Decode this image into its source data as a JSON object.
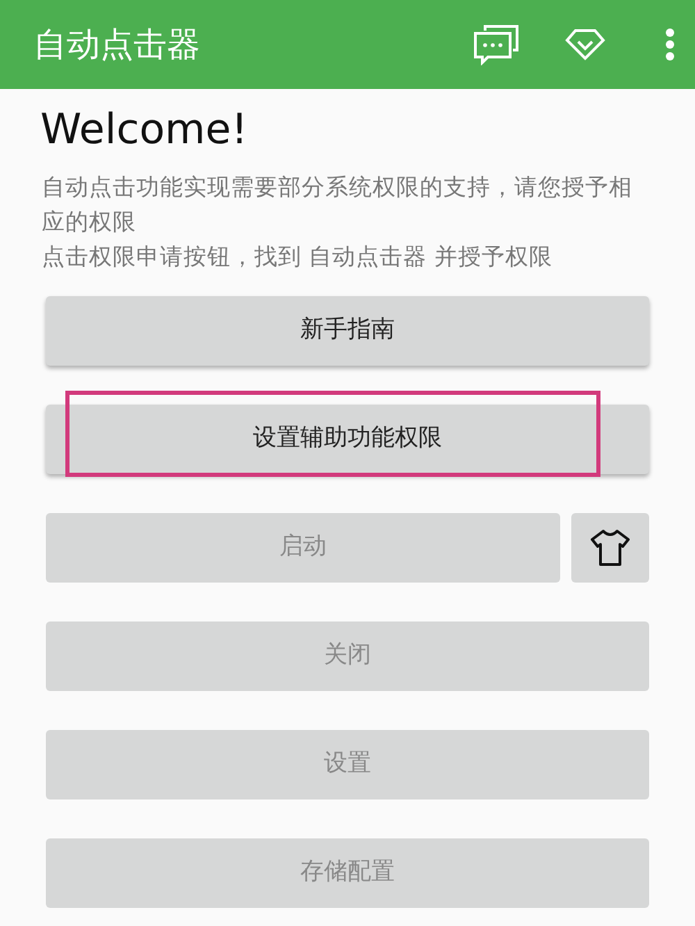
{
  "app_bar": {
    "title": "自动点击器"
  },
  "welcome": "Welcome!",
  "description": [
    "自动点击功能实现需要部分系统权限的支持，请您授予相应的权限",
    "点击权限申请按钮，找到 自动点击器 并授予权限"
  ],
  "buttons": [
    {
      "label": "新手指南",
      "disabled": false,
      "highlighted": false
    },
    {
      "label": "设置辅助功能权限",
      "disabled": false,
      "highlighted": true
    },
    {
      "label": "启动",
      "disabled": true,
      "highlighted": false,
      "kind": "with-icon"
    },
    {
      "label": "关闭",
      "disabled": true,
      "highlighted": false
    },
    {
      "label": "设置",
      "disabled": true,
      "highlighted": false
    },
    {
      "label": "存储配置",
      "disabled": true,
      "highlighted": false
    }
  ]
}
